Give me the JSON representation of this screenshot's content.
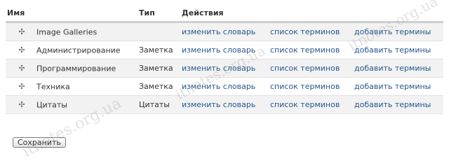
{
  "table": {
    "headers": {
      "name": "Имя",
      "type": "Тип",
      "actions": "Действия"
    },
    "rows": [
      {
        "name": "Image Galleries",
        "type": "",
        "edit": "изменить словарь",
        "list": "список терминов",
        "add": "добавить термины"
      },
      {
        "name": "Администрирование",
        "type": "Заметка",
        "edit": "изменить словарь",
        "list": "список терминов",
        "add": "добавить термины"
      },
      {
        "name": "Программирование",
        "type": "Заметка",
        "edit": "изменить словарь",
        "list": "список терминов",
        "add": "добавить термины"
      },
      {
        "name": "Техника",
        "type": "Заметка",
        "edit": "изменить словарь",
        "list": "список терминов",
        "add": "добавить термины"
      },
      {
        "name": "Цитаты",
        "type": "Цитаты",
        "edit": "изменить словарь",
        "list": "список терминов",
        "add": "добавить термины"
      }
    ]
  },
  "drag_icon": "move-arrows-icon",
  "save_label": "Сохранить",
  "watermark": "itnotes.org.ua",
  "colors": {
    "link": "#27578f",
    "row_alt": "#f2f2f2",
    "header_border": "#cfcfcf"
  }
}
